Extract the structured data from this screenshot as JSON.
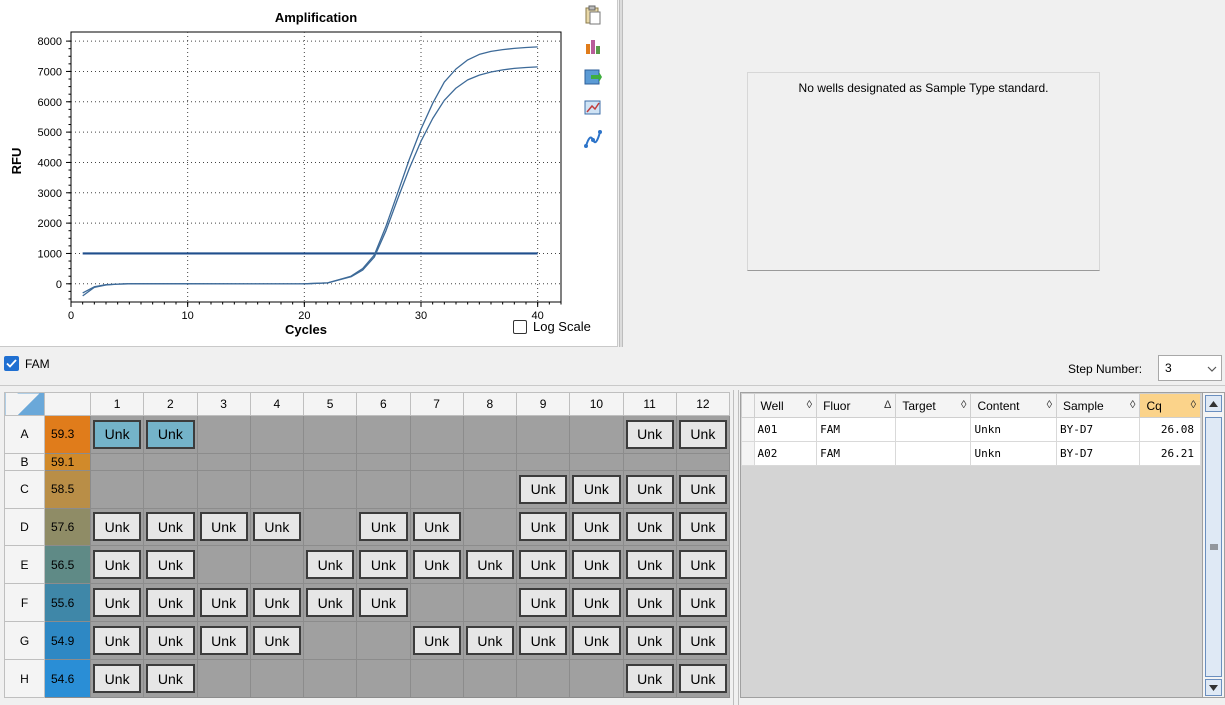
{
  "chart_data": {
    "type": "line",
    "title": "Amplification",
    "xlabel": "Cycles",
    "ylabel": "RFU",
    "xlim": [
      0,
      42
    ],
    "ylim": [
      -600,
      8300
    ],
    "xticks": [
      0,
      10,
      20,
      30,
      40
    ],
    "yticks": [
      0,
      1000,
      2000,
      3000,
      4000,
      5000,
      6000,
      7000,
      8000
    ],
    "threshold": 1000,
    "grid": true,
    "series": [
      {
        "values": [
          [
            1,
            -400
          ],
          [
            2,
            -120
          ],
          [
            3,
            -40
          ],
          [
            4,
            -10
          ],
          [
            5,
            0
          ],
          [
            10,
            0
          ],
          [
            15,
            -5
          ],
          [
            20,
            0
          ],
          [
            22,
            30
          ],
          [
            24,
            250
          ],
          [
            25,
            500
          ],
          [
            26,
            950
          ],
          [
            27,
            1900
          ],
          [
            28,
            3000
          ],
          [
            29,
            4100
          ],
          [
            30,
            5100
          ],
          [
            31,
            5950
          ],
          [
            32,
            6650
          ],
          [
            33,
            7080
          ],
          [
            34,
            7380
          ],
          [
            35,
            7560
          ],
          [
            36,
            7660
          ],
          [
            37,
            7720
          ],
          [
            38,
            7760
          ],
          [
            39,
            7790
          ],
          [
            40,
            7810
          ]
        ]
      },
      {
        "values": [
          [
            1,
            -300
          ],
          [
            2,
            -100
          ],
          [
            3,
            -30
          ],
          [
            4,
            -10
          ],
          [
            5,
            0
          ],
          [
            10,
            0
          ],
          [
            15,
            -5
          ],
          [
            20,
            0
          ],
          [
            22,
            30
          ],
          [
            24,
            230
          ],
          [
            25,
            450
          ],
          [
            26,
            880
          ],
          [
            27,
            1750
          ],
          [
            28,
            2800
          ],
          [
            29,
            3800
          ],
          [
            30,
            4700
          ],
          [
            31,
            5450
          ],
          [
            32,
            6050
          ],
          [
            33,
            6450
          ],
          [
            34,
            6720
          ],
          [
            35,
            6880
          ],
          [
            36,
            6980
          ],
          [
            37,
            7050
          ],
          [
            38,
            7100
          ],
          [
            39,
            7130
          ],
          [
            40,
            7150
          ]
        ]
      }
    ],
    "series_color": "#3d6a98",
    "threshold_color": "#1f4e8c"
  },
  "log_scale_label": "Log Scale",
  "standard_message": "No wells designated as Sample Type standard.",
  "fluor_checkbox_label": "FAM",
  "step_number_label": "Step Number:",
  "step_number_value": "3",
  "plate": {
    "columns": [
      "1",
      "2",
      "3",
      "4",
      "5",
      "6",
      "7",
      "8",
      "9",
      "10",
      "11",
      "12"
    ],
    "rows": [
      {
        "label": "A",
        "temp": "59.3",
        "color": "#e07c1b",
        "wells": [
          "sel",
          "sel",
          "",
          "",
          "",
          "",
          "",
          "",
          "",
          "",
          "Unk",
          "Unk"
        ]
      },
      {
        "label": "B",
        "temp": "59.1",
        "color": "#d18a2a",
        "wells": [
          "",
          "",
          "",
          "",
          "",
          "",
          "",
          "",
          "",
          "",
          "",
          ""
        ]
      },
      {
        "label": "C",
        "temp": "58.5",
        "color": "#b98e47",
        "wells": [
          "",
          "",
          "",
          "",
          "",
          "",
          "",
          "",
          "Unk",
          "Unk",
          "Unk",
          "Unk"
        ]
      },
      {
        "label": "D",
        "temp": "57.6",
        "color": "#8f8c66",
        "wells": [
          "Unk",
          "Unk",
          "Unk",
          "Unk",
          "",
          "Unk",
          "Unk",
          "",
          "Unk",
          "Unk",
          "Unk",
          "Unk"
        ]
      },
      {
        "label": "E",
        "temp": "56.5",
        "color": "#5f8a86",
        "wells": [
          "Unk",
          "Unk",
          "",
          "",
          "Unk",
          "Unk",
          "Unk",
          "Unk",
          "Unk",
          "Unk",
          "Unk",
          "Unk"
        ]
      },
      {
        "label": "F",
        "temp": "55.6",
        "color": "#3f87a8",
        "wells": [
          "Unk",
          "Unk",
          "Unk",
          "Unk",
          "Unk",
          "Unk",
          "",
          "",
          "Unk",
          "Unk",
          "Unk",
          "Unk"
        ]
      },
      {
        "label": "G",
        "temp": "54.9",
        "color": "#2e88c4",
        "wells": [
          "Unk",
          "Unk",
          "Unk",
          "Unk",
          "",
          "",
          "Unk",
          "Unk",
          "Unk",
          "Unk",
          "Unk",
          "Unk"
        ]
      },
      {
        "label": "H",
        "temp": "54.6",
        "color": "#2a8ed6",
        "wells": [
          "Unk",
          "Unk",
          "",
          "",
          "",
          "",
          "",
          "",
          "",
          "",
          "Unk",
          "Unk"
        ]
      }
    ],
    "well_label": "Unk"
  },
  "results": {
    "columns": [
      {
        "label": "Well",
        "sort": "◊"
      },
      {
        "label": "Fluor",
        "sort": "Δ"
      },
      {
        "label": "Target",
        "sort": "◊"
      },
      {
        "label": "Content",
        "sort": "◊"
      },
      {
        "label": "Sample",
        "sort": "◊"
      },
      {
        "label": "Cq",
        "sort": "◊"
      }
    ],
    "rows": [
      [
        "A01",
        "FAM",
        "",
        "Unkn",
        "BY-D7",
        "26.08"
      ],
      [
        "A02",
        "FAM",
        "",
        "Unkn",
        "BY-D7",
        "26.21"
      ]
    ]
  }
}
